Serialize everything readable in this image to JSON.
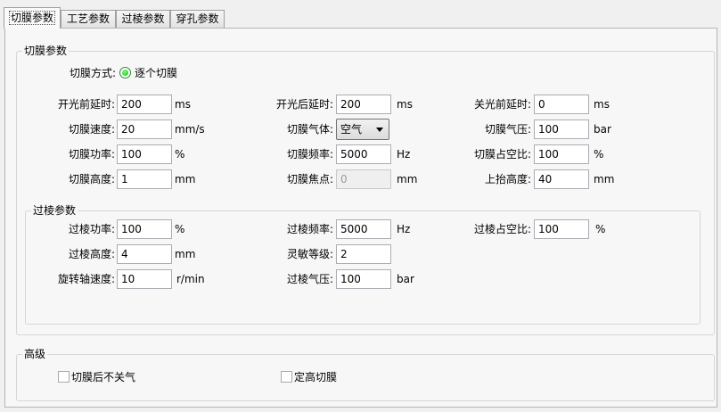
{
  "tabs": [
    {
      "label": "切膜参数",
      "active": true
    },
    {
      "label": "工艺参数",
      "active": false
    },
    {
      "label": "过棱参数",
      "active": false
    },
    {
      "label": "穿孔参数",
      "active": false
    }
  ],
  "cut_film": {
    "title": "切膜参数",
    "method_label": "切膜方式:",
    "method_option": "逐个切膜",
    "fields": {
      "on_pre_delay": {
        "label": "开光前延时:",
        "value": "200",
        "unit": "ms"
      },
      "on_post_delay": {
        "label": "开光后延时:",
        "value": "200",
        "unit": "ms"
      },
      "off_pre_delay": {
        "label": "关光前延时:",
        "value": "0",
        "unit": "ms"
      },
      "speed": {
        "label": "切膜速度:",
        "value": "20",
        "unit": "mm/s"
      },
      "gas": {
        "label": "切膜气体:",
        "value": "空气"
      },
      "gas_pressure": {
        "label": "切膜气压:",
        "value": "100",
        "unit": "bar"
      },
      "power": {
        "label": "切膜功率:",
        "value": "100",
        "unit": "%"
      },
      "frequency": {
        "label": "切膜频率:",
        "value": "5000",
        "unit": "Hz"
      },
      "duty": {
        "label": "切膜占空比:",
        "value": "100",
        "unit": "%"
      },
      "height": {
        "label": "切膜高度:",
        "value": "1",
        "unit": "mm"
      },
      "focus": {
        "label": "切膜焦点:",
        "value": "0",
        "unit": "mm"
      },
      "lift": {
        "label": "上抬高度:",
        "value": "40",
        "unit": "mm"
      }
    }
  },
  "edge": {
    "title": "过棱参数",
    "fields": {
      "power": {
        "label": "过棱功率:",
        "value": "100",
        "unit": "%"
      },
      "frequency": {
        "label": "过棱频率:",
        "value": "5000",
        "unit": "Hz"
      },
      "duty": {
        "label": "过棱占空比:",
        "value": "100",
        "unit": "%"
      },
      "height": {
        "label": "过棱高度:",
        "value": "4",
        "unit": "mm"
      },
      "sensitivity": {
        "label": "灵敏等级:",
        "value": "2"
      },
      "rotation": {
        "label": "旋转轴速度:",
        "value": "10",
        "unit": "r/min"
      },
      "pressure": {
        "label": "过棱气压:",
        "value": "100",
        "unit": "bar"
      }
    }
  },
  "advanced": {
    "title": "高级",
    "keep_gas": {
      "label": "切膜后不关气",
      "checked": false
    },
    "fixed_height": {
      "label": "定高切膜",
      "checked": false
    }
  }
}
